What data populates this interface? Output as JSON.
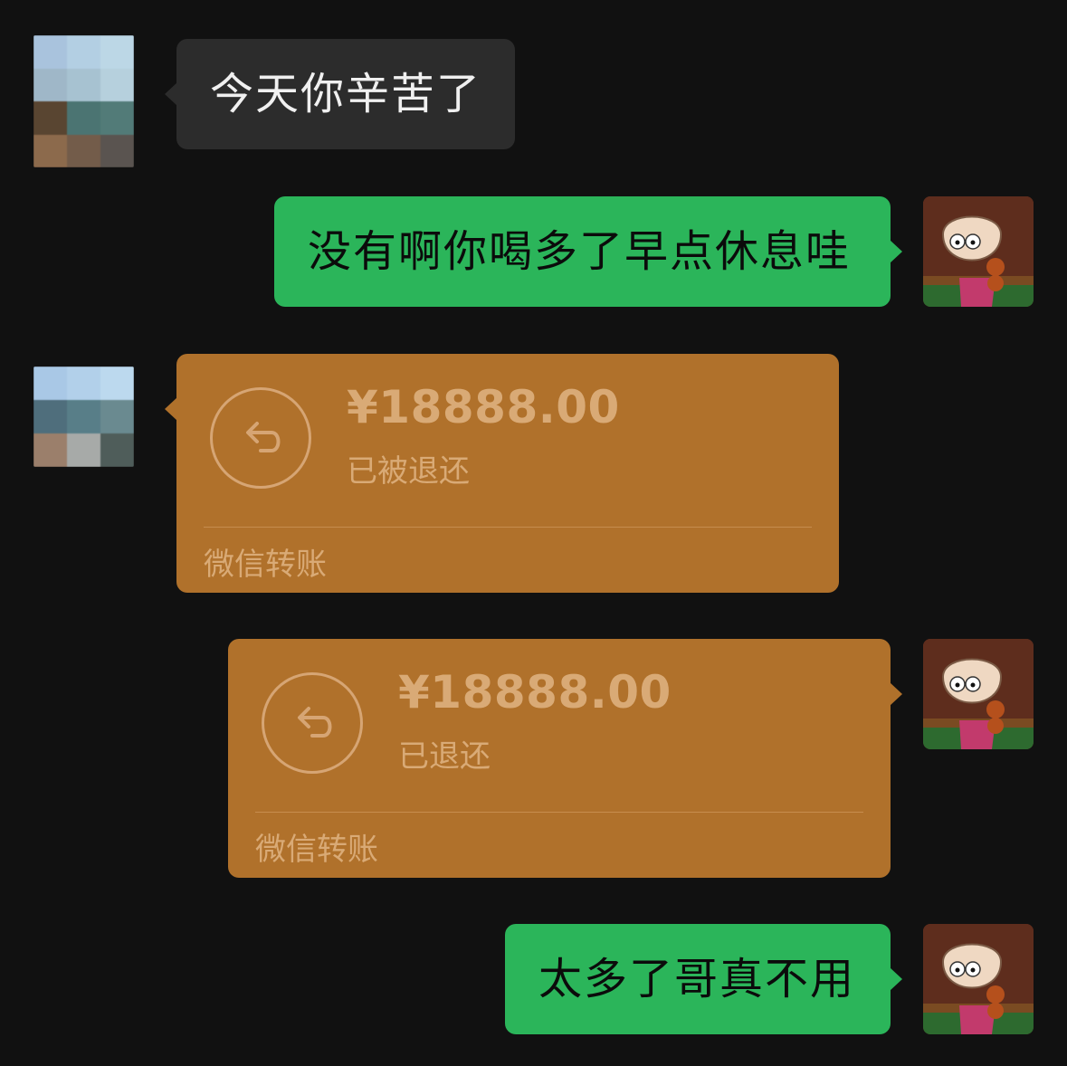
{
  "messages": [
    {
      "type": "text",
      "side": "in",
      "text": "今天你辛苦了"
    },
    {
      "type": "text",
      "side": "out",
      "text": "没有啊你喝多了早点休息哇"
    },
    {
      "type": "transfer",
      "side": "in",
      "amount": "¥18888.00",
      "status": "已被退还",
      "footer": "微信转账"
    },
    {
      "type": "transfer",
      "side": "out",
      "amount": "¥18888.00",
      "status": "已退还",
      "footer": "微信转账"
    },
    {
      "type": "text",
      "side": "out",
      "text": "太多了哥真不用"
    }
  ],
  "colors": {
    "background": "#111111",
    "incoming_bubble": "#2c2c2c",
    "outgoing_bubble": "#2bb55a",
    "transfer_card": "#b0712b"
  }
}
